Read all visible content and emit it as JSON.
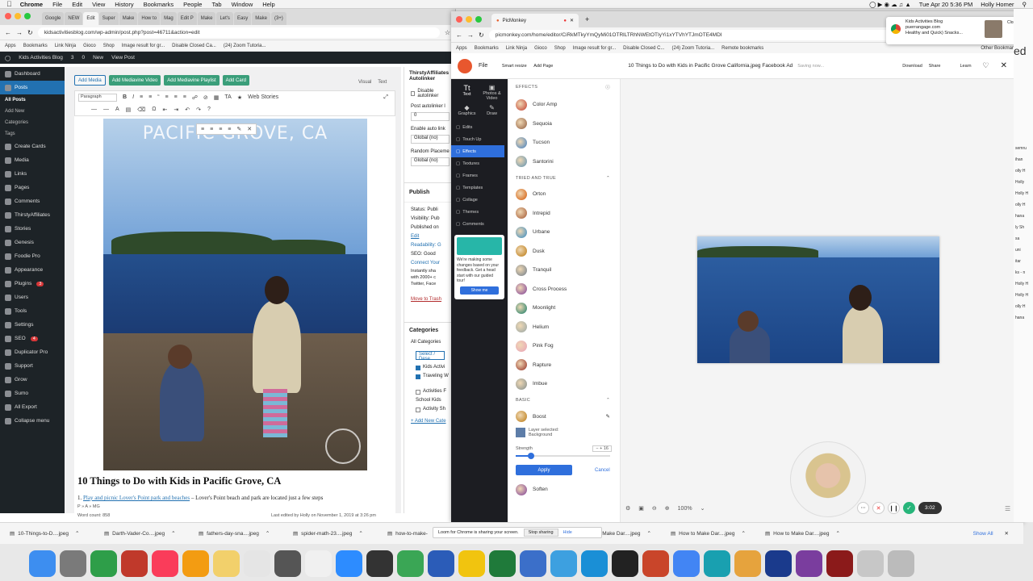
{
  "menubar": {
    "app": "Chrome",
    "items": [
      "File",
      "Edit",
      "View",
      "History",
      "Bookmarks",
      "People",
      "Tab",
      "Window",
      "Help"
    ],
    "clock": "Tue Apr 20  5:36 PM",
    "user": "Holly Homer"
  },
  "left_window": {
    "tabs": [
      "Google",
      "NEW",
      "Edit",
      "Super",
      "Make",
      "How to",
      "Mag",
      "Edit P",
      "Make",
      "Let's",
      "Easy",
      "Make",
      "(3+)"
    ],
    "url": "kidsactivitiesblog.com/wp-admin/post.php?post=46711&action=edit",
    "bookmarks": [
      "Apps",
      "Bookmarks",
      "Link Ninja",
      "Gioco",
      "Shop",
      "Image result for gr...",
      "Disable Closed Ca...",
      "(24) Zoom Tutoria..."
    ],
    "adminbar": [
      "Kids Activities Blog",
      "3",
      "0",
      "New",
      "View Post"
    ],
    "menu": [
      {
        "label": "Dashboard"
      },
      {
        "label": "Posts",
        "current": true
      },
      {
        "label": "All Posts",
        "sub": true,
        "bold": true
      },
      {
        "label": "Add New",
        "sub": true
      },
      {
        "label": "Categories",
        "sub": true
      },
      {
        "label": "Tags",
        "sub": true
      },
      {
        "label": "Create Cards"
      },
      {
        "label": "Media"
      },
      {
        "label": "Links"
      },
      {
        "label": "Pages"
      },
      {
        "label": "Comments"
      },
      {
        "label": "ThirstyAffiliates"
      },
      {
        "label": "Stories"
      },
      {
        "label": "Genesis"
      },
      {
        "label": "Foodie Pro"
      },
      {
        "label": "Appearance"
      },
      {
        "label": "Plugins",
        "badge": "3"
      },
      {
        "label": "Users"
      },
      {
        "label": "Tools"
      },
      {
        "label": "Settings"
      },
      {
        "label": "SEO",
        "badge": "4"
      },
      {
        "label": "Duplicator Pro"
      },
      {
        "label": "Support"
      },
      {
        "label": "Grow"
      },
      {
        "label": "Sumo"
      },
      {
        "label": "All Export"
      },
      {
        "label": "Collapse menu"
      }
    ],
    "editor": {
      "buttons": [
        "Add Media",
        "Add Mediavine Video",
        "Add Mediavine Playlist",
        "Add Card"
      ],
      "tabs": [
        "Visual",
        "Text"
      ],
      "format": "Paragraph",
      "web_stories": "Web Stories",
      "image_caption": "PACIFIC GROVE, CA",
      "heading": "10 Things to Do with Kids in Pacific Grove, CA",
      "list_link": "Play and picnic Lover's Point park and beaches",
      "list_rest": " – Lover's Point beach and park are located just a few steps",
      "path": "P » A » MG",
      "word_count": "Word count: 858",
      "last_edited": "Last edited by Holly on November 1, 2019 at 3:26 pm"
    },
    "meta": {
      "thirsty_title": "ThirstyAffiliates Autolinker",
      "disable_autolinker": "Disable autolinker",
      "post_autolinker": "Post autolinker l",
      "limit": "0",
      "enable_autolinker": "Enable auto link",
      "global1": "Global (no)",
      "random_placement": "Random Placeme",
      "global2": "Global (no)",
      "publish": "Publish",
      "status": "Status: Publi",
      "visibility": "Visibility: Pub",
      "published_on": "Published on",
      "edit": "Edit",
      "readability": "Readability: G",
      "seo": "SEO: Good",
      "connect": "Connect Your",
      "instantly": "Instantly sha",
      "with2000": "with 2000+ c",
      "twitter": "Twitter, Face",
      "trash": "Move to Trash",
      "categories": "Categories",
      "all_categories": "All Categories",
      "select": "Select / Dese",
      "cat_items": [
        "Kids Activi",
        "Traveling W",
        "Activities F",
        "School Kids",
        "Activity Sh"
      ],
      "add_new_cat": "+ Add New Cate"
    }
  },
  "right_window": {
    "tab": "PicMonkey",
    "url": "picmonkey.com/home/editor/CiRkMTkyYmQyMi01OTRlLTRhNWEtOTIyYi1xYTVhYTJmOTE4MDI",
    "bookmarks": [
      "Apps",
      "Bookmarks",
      "Link Ninja",
      "Gioco",
      "Shop",
      "Image result for gr...",
      "Disable Closed C...",
      "(24) Zoom Tutoria...",
      "Remote bookmarks",
      "Other Bookmarks"
    ],
    "top": {
      "file": "File",
      "smart_resize": "Smart resize",
      "add_page": "Add Page",
      "doc_title": "10 Things to Do with Kids in Pacific Grove California.jpeg Facebook Ad",
      "saving": "Saving now...",
      "download": "Download",
      "share": "Share",
      "learn": "Learn"
    },
    "rail": {
      "text": "Text",
      "photos": "Photos & Video",
      "graphics": "Graphics",
      "draw": "Draw",
      "items": [
        "Edits",
        "Touch Up",
        "Effects",
        "Textures",
        "Frames",
        "Templates",
        "Collage",
        "Themes",
        "Comments"
      ],
      "promo": "We're making some changes based on your feedback. Get a head start with our guided tour!",
      "promo_btn": "Show me"
    },
    "effects": {
      "title": "EFFECTS",
      "top_items": [
        "Color Amp",
        "Sequoia",
        "Tucson",
        "Santorini"
      ],
      "section1": "TRIED AND TRUE",
      "tried": [
        "Orton",
        "Intrepid",
        "Urbane",
        "Dusk",
        "Tranquil",
        "Cross Process",
        "Moonlight",
        "Helium",
        "Pink Fog",
        "Rapture",
        "Imbue"
      ],
      "section2": "BASIC",
      "boost": "Boost",
      "layer_selected": "Layer selected:",
      "layer_name": "Background",
      "strength_label": "Strength",
      "strength_value": "16",
      "strength_fraction": 0.16,
      "apply": "Apply",
      "cancel": "Cancel",
      "next": "Soften"
    },
    "zoom": "100%",
    "timer": "3:02"
  },
  "notification": {
    "title": "Kids Activities Blog",
    "domain": "puerrangage.com",
    "text": "Healthy and Quick) Snacks...",
    "close": "Close"
  },
  "share_bar": {
    "text": "Loom for Chrome is sharing your screen.",
    "stop": "Stop sharing",
    "hide": "Hide"
  },
  "downloads": [
    "10-Things-to-D....jpeg",
    "Darth-Vader-Co....jpeg",
    "fathers-day-sna....jpeg",
    "spider-math-23....jpeg",
    "how-to-make-",
    "",
    "How to Make Dar....jpeg",
    "How to Make Dar....jpeg",
    "How to Make Dar....jpeg"
  ],
  "downloads_show_all": "Show All",
  "dock": [
    "Finder",
    "Launchpad",
    "Numbers",
    "Nope",
    "Music",
    "Books",
    "Stickies",
    "Photos",
    "Utility",
    "TextEdit",
    "Zoom",
    "Camera",
    "Maps",
    "Word",
    "Norton",
    "Excel",
    "Group",
    "Utility2",
    "Skype",
    "QuickTime",
    "PowerPoint",
    "Chrome",
    "App",
    "Slack",
    "WD",
    "Photo",
    "Script",
    "Preview",
    "Trash"
  ],
  "right_edge": [
    "ed",
    "semru",
    "ihan",
    "olly H",
    "Holly",
    "Holly H",
    "olly H",
    "hana",
    "ly Sh",
    "sa",
    "uni",
    "itar",
    "ks - n",
    "Holly H",
    "Holly H",
    "olly H",
    "hana"
  ]
}
